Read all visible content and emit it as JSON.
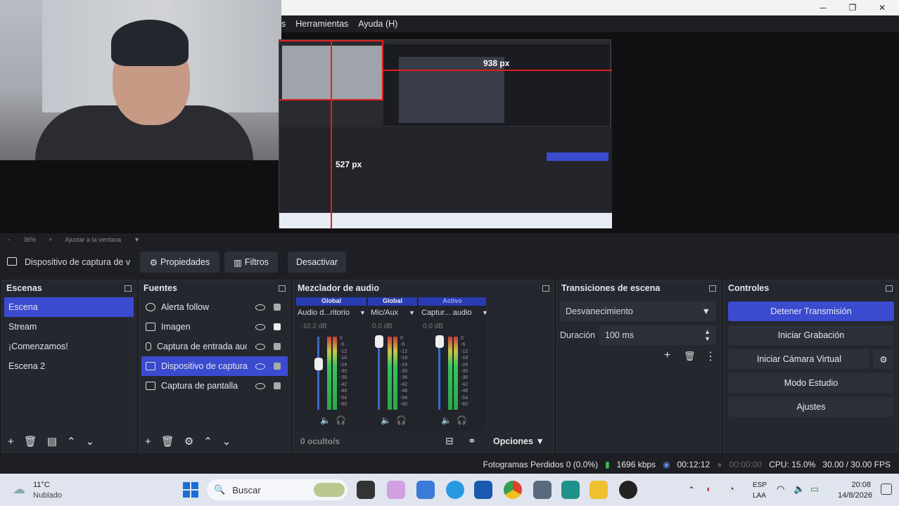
{
  "menu": {
    "partial": "s",
    "tools": "Herramientas",
    "help": "Ayuda (H)"
  },
  "window": {
    "minimize": "─",
    "maximize": "❐",
    "close": "✕"
  },
  "preview": {
    "zoom": "36%",
    "fit": "Ajustar a la ventana",
    "width_label": "938 px",
    "height_label": "527 px"
  },
  "toolbar": {
    "source_name": "Dispositivo de captura de v",
    "properties": "Propiedades",
    "filters": "Filtros",
    "deactivate": "Desactivar"
  },
  "scenes": {
    "title": "Escenas",
    "items": [
      "Escena",
      "Stream",
      "¡Comenzamos!",
      "Escena 2"
    ],
    "selected_index": 0
  },
  "sources": {
    "title": "Fuentes",
    "items": [
      "Alerta follow",
      "Imagen",
      "Captura de entrada auc",
      "Dispositivo de captura",
      "Captura de pantalla"
    ],
    "selected_index": 3
  },
  "mixer": {
    "title": "Mezclador de audio",
    "channels": [
      {
        "tag": "Global",
        "name": "Audio d...ritorio",
        "db": "-10.2 dB"
      },
      {
        "tag": "Global",
        "name": "Mic/Aux",
        "db": "0.0 dB"
      },
      {
        "tag": "Activo",
        "name": "Captur... audio",
        "db": "0.0 dB"
      }
    ],
    "scale": [
      "0",
      "-6",
      "-12",
      "-18",
      "-24",
      "-30",
      "-36",
      "-42",
      "-48",
      "-54",
      "-60"
    ],
    "hidden": "0 oculto/s",
    "options": "Opciones"
  },
  "transitions": {
    "title": "Transiciones de escena",
    "selected": "Desvanecimiento",
    "duration_label": "Duración",
    "duration_value": "100 ms"
  },
  "controls": {
    "title": "Controles",
    "stop_stream": "Detener Transmisión",
    "start_recording": "Iniciar Grabación",
    "virtual_camera": "Iniciar Cámara Virtual",
    "studio_mode": "Modo Estudio",
    "settings": "Ajustes"
  },
  "status": {
    "dropped": "Fotogramas Perdidos 0 (0.0%)",
    "bitrate": "1696 kbps",
    "stream_time": "00:12:12",
    "rec_time": "00:00:00",
    "cpu": "CPU: 15.0%",
    "fps": "30.00 / 30.00 FPS"
  },
  "taskbar": {
    "temp": "11°C",
    "weather": "Nublado",
    "search": "Buscar",
    "lang": "ESP",
    "region": "LAA",
    "time": "20:08",
    "date": "14/8/2026"
  },
  "colors": {
    "accent": "#3a4bcf",
    "panel": "#25272e",
    "bg": "#1e1f24",
    "active_button": "#3a4bcf"
  }
}
